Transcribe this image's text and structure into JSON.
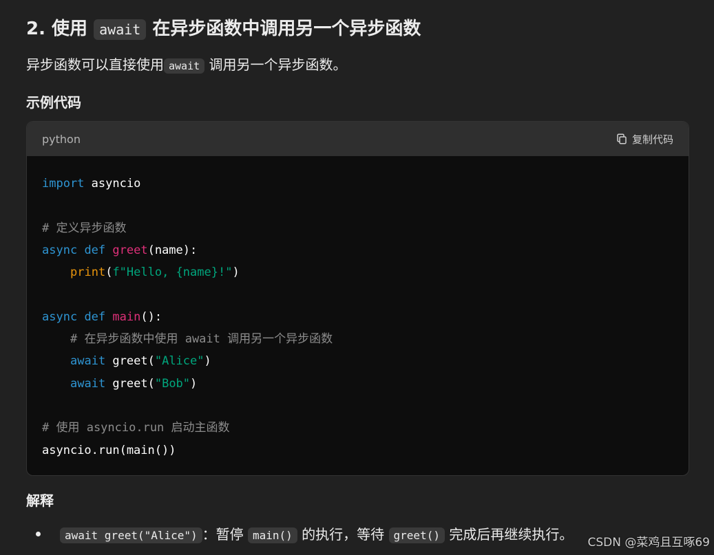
{
  "heading": {
    "number": "2.",
    "pre": "使用",
    "code": "await",
    "post": "在异步函数中调用另一个异步函数"
  },
  "description": {
    "pre": "异步函数可以直接使用",
    "code": "await",
    "post": "调用另一个异步函数。"
  },
  "example_title": "示例代码",
  "code_block": {
    "language": "python",
    "copy_label": "复制代码",
    "lines": {
      "l1": {
        "kw": "import",
        "rest": " asyncio"
      },
      "l3": "# 定义异步函数",
      "l4": {
        "kw1": "async",
        "kw2": "def",
        "fn": "greet",
        "rest": "(name):"
      },
      "l5": {
        "builtin": "print",
        "open": "(",
        "str": "f\"Hello, {name}!\"",
        "close": ")"
      },
      "l7": {
        "kw1": "async",
        "kw2": "def",
        "fn": "main",
        "rest": "():"
      },
      "l8": "# 在异步函数中使用 await 调用另一个异步函数",
      "l9": {
        "kw": "await",
        "call": " greet(",
        "str": "\"Alice\"",
        "close": ")"
      },
      "l10": {
        "kw": "await",
        "call": " greet(",
        "str": "\"Bob\"",
        "close": ")"
      },
      "l12": "# 使用 asyncio.run 启动主函数",
      "l13": "asyncio.run(main())"
    }
  },
  "explain_title": "解释",
  "bullet": {
    "code1": "await greet(\"Alice\")",
    "t1": "：暂停",
    "code2": "main()",
    "t2": "的执行，等待",
    "code3": "greet()",
    "t3": "完成后再继续执行。"
  },
  "watermark": "CSDN @菜鸡且互啄69"
}
